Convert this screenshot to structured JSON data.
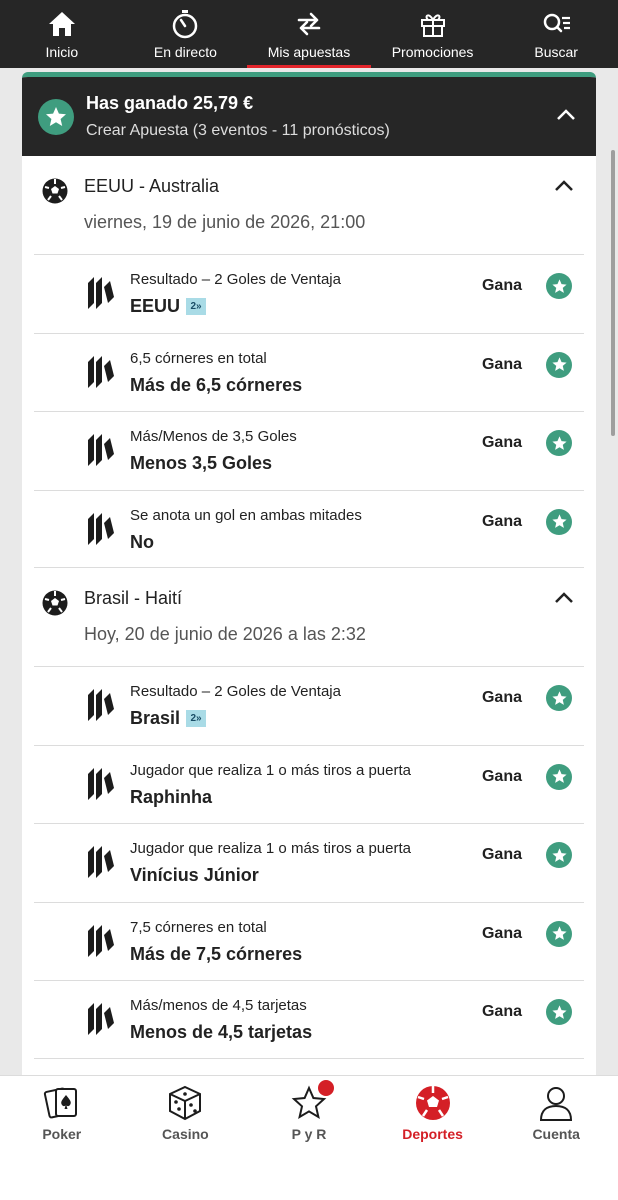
{
  "topnav": [
    {
      "label": "Inicio",
      "icon": "home-icon"
    },
    {
      "label": "En directo",
      "icon": "stopwatch-icon"
    },
    {
      "label": "Mis apuestas",
      "icon": "refresh-icon",
      "active": true
    },
    {
      "label": "Promociones",
      "icon": "gift-icon"
    },
    {
      "label": "Buscar",
      "icon": "search-icon"
    }
  ],
  "bet": {
    "won_label": "Has ganado 25,79 €",
    "subtitle": "Crear Apuesta (3 eventos - 11 pronósticos)"
  },
  "events": [
    {
      "name": "EEUU - Australia",
      "date": "viernes, 19 de junio de 2026, 21:00",
      "selections": [
        {
          "market": "Resultado – 2 Goles de Ventaja",
          "pick": "EEUU",
          "tag": "2»",
          "result": "Gana"
        },
        {
          "market": "6,5 córneres en total",
          "pick": "Más de 6,5 córneres",
          "result": "Gana"
        },
        {
          "market": "Más/Menos de 3,5 Goles",
          "pick": "Menos 3,5 Goles",
          "result": "Gana"
        },
        {
          "market": "Se anota un gol en ambas mitades",
          "pick": "No",
          "result": "Gana"
        }
      ]
    },
    {
      "name": "Brasil - Haití",
      "date": "Hoy, 20 de junio de 2026 a las 2:32",
      "selections": [
        {
          "market": "Resultado – 2 Goles de Ventaja",
          "pick": "Brasil",
          "tag": "2»",
          "result": "Gana"
        },
        {
          "market": "Jugador que realiza 1 o más tiros a puerta",
          "pick": "Raphinha",
          "result": "Gana"
        },
        {
          "market": "Jugador que realiza 1 o más tiros a puerta",
          "pick": "Vinícius Júnior",
          "result": "Gana"
        },
        {
          "market": "7,5 córneres en total",
          "pick": "Más de 7,5 córneres",
          "result": "Gana"
        },
        {
          "market": "Más/menos de 4,5 tarjetas",
          "pick": "Menos de 4,5 tarjetas",
          "result": "Gana"
        }
      ]
    }
  ],
  "bottomnav": [
    {
      "label": "Poker",
      "icon": "poker-cards-icon"
    },
    {
      "label": "Casino",
      "icon": "dice-icon"
    },
    {
      "label": "P y R",
      "icon": "star-outline-icon",
      "badge": true
    },
    {
      "label": "Deportes",
      "icon": "soccer-ball-icon",
      "active": true
    },
    {
      "label": "Cuenta",
      "icon": "user-icon"
    }
  ],
  "colors": {
    "accent_green": "#3f9d7f",
    "brand_red": "#d41f26",
    "header_dark": "#262626"
  }
}
